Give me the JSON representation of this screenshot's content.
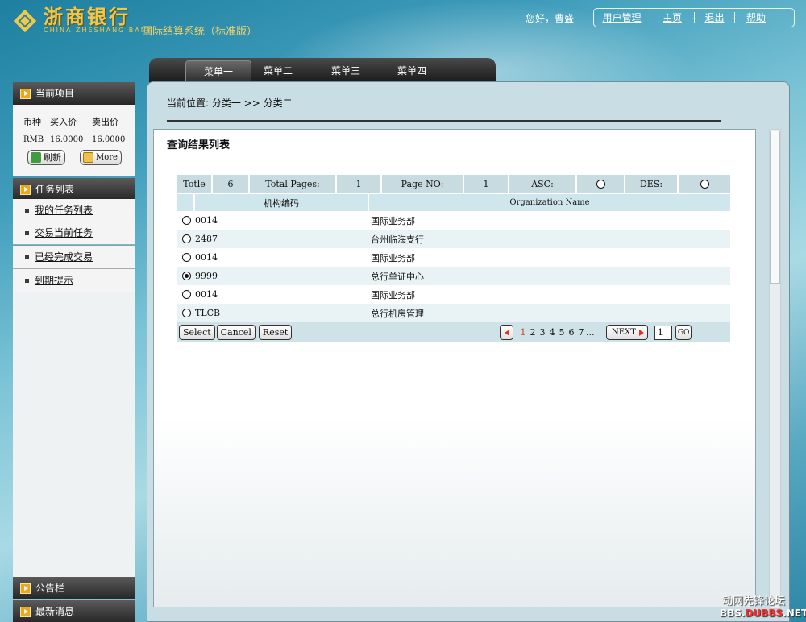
{
  "header": {
    "bank_name_cn": "浙商银行",
    "bank_name_en": "CHINA ZHESHANG BANK",
    "system_name": "国际结算系统（标准版）",
    "greeting": "您好，曹盛",
    "links": [
      "用户管理",
      "主页",
      "退出",
      "帮助"
    ]
  },
  "menu": {
    "items": [
      "菜单一",
      "菜单二",
      "菜单三",
      "菜单四"
    ],
    "active_index": 0
  },
  "sidebar": {
    "current_items_title": "当前项目",
    "rates_header": [
      "币种",
      "买入价",
      "卖出价"
    ],
    "rates": [
      [
        "RMB",
        "16.0000",
        "16.0000"
      ]
    ],
    "refresh_label": "刷新",
    "more_label": "More",
    "task_list_title": "任务列表",
    "tasks": [
      "我的任务列表",
      "交易当前任务",
      "已经完成交易",
      "到期提示"
    ],
    "bulletin_title": "公告栏",
    "news_title": "最新消息"
  },
  "main": {
    "breadcrumb": "当前位置: 分类一 >> 分类二",
    "title": "查询结果列表",
    "stats": {
      "total_label": "Totle",
      "total_value": "6",
      "pages_label": "Total Pages:",
      "pages_value": "1",
      "page_no_label": "Page NO:",
      "page_no_value": "1",
      "asc_label": "ASC:",
      "des_label": "DES:"
    },
    "columns": [
      "机构编码",
      "Organization Name"
    ],
    "rows": [
      {
        "code": "0014",
        "name": "国际业务部",
        "selected": false
      },
      {
        "code": "2487",
        "name": "台州临海支行",
        "selected": false
      },
      {
        "code": "0014",
        "name": "国际业务部",
        "selected": false
      },
      {
        "code": "9999",
        "name": "总行单证中心",
        "selected": true
      },
      {
        "code": "0014",
        "name": "国际业务部",
        "selected": false
      },
      {
        "code": "TLCB",
        "name": "总行机房管理",
        "selected": false
      }
    ],
    "buttons": [
      "Select",
      "Cancel",
      "Reset"
    ],
    "pager": {
      "pages": [
        "1",
        "2",
        "3",
        "4",
        "5",
        "6",
        "7"
      ],
      "ellipsis": "...",
      "next_label": "NEXT",
      "page_input": "1",
      "go_label": "GO"
    }
  },
  "watermark": {
    "line1": "动网先锋论坛",
    "line2_a": "BBS.",
    "line2_b": "DUBBS",
    "line2_c": ".NET"
  },
  "colors": {
    "accent_gold": "#f2c84b",
    "pager_red": "#d6391f",
    "table_header": "#c7dbe1"
  }
}
